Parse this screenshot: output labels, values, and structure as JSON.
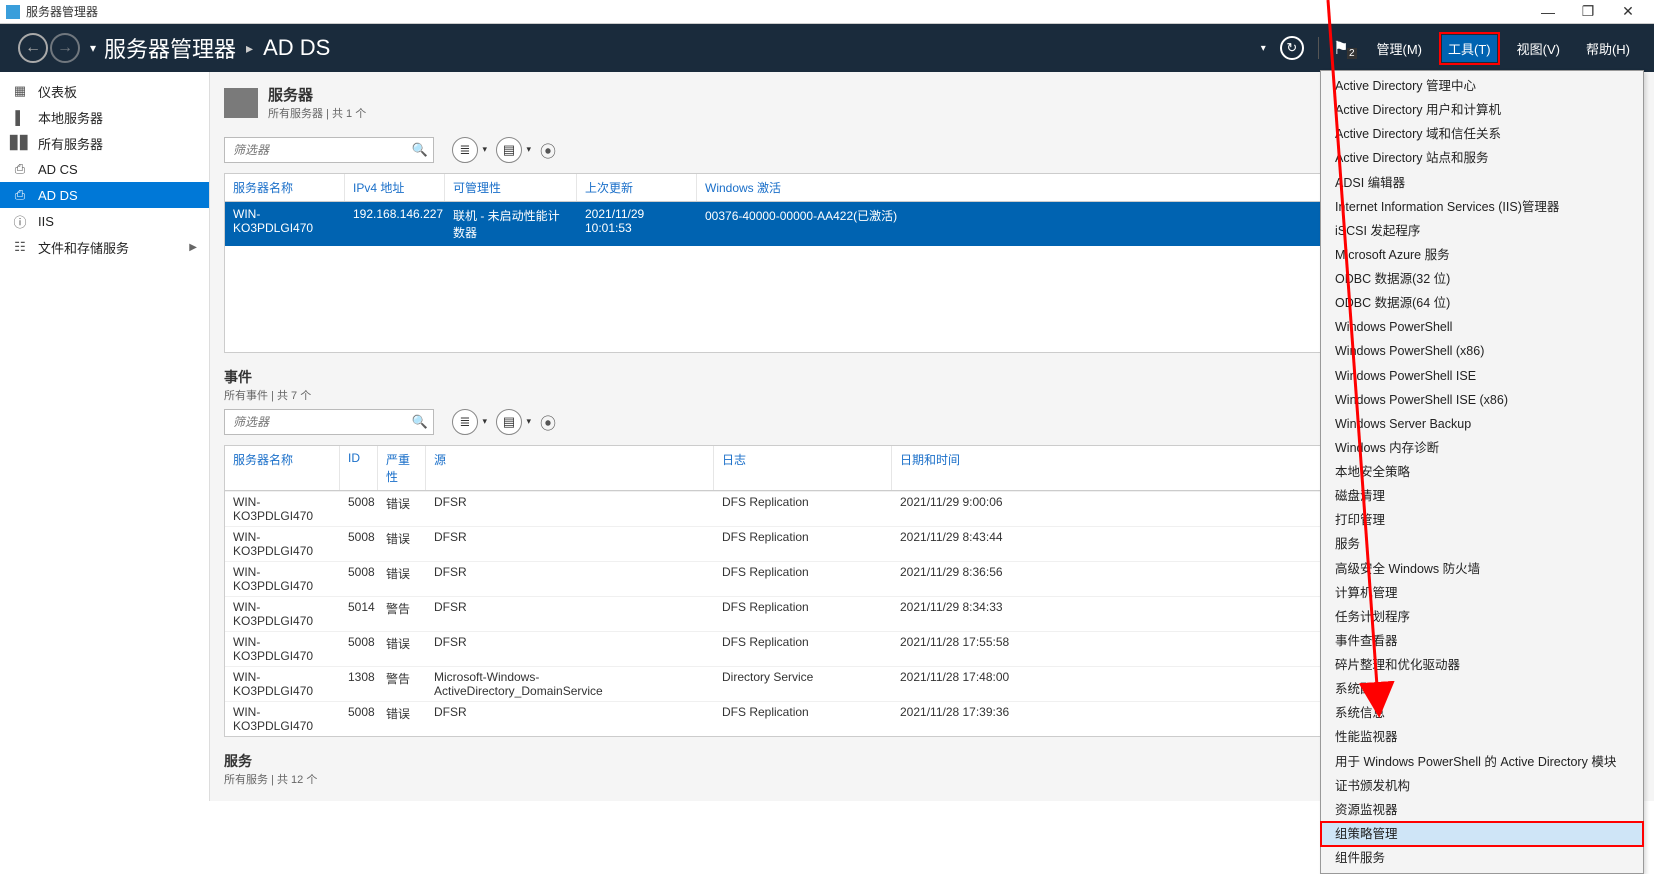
{
  "window": {
    "title": "服务器管理器",
    "min": "—",
    "max": "❐",
    "close": "✕"
  },
  "header": {
    "crumb1": "服务器管理器",
    "crumb2": "AD DS",
    "refresh_icon": "↻",
    "flag_icon": "⚑",
    "flag_count": "2",
    "menu_manage": "管理(M)",
    "menu_tools": "工具(T)",
    "menu_view_partial": "视图(V)",
    "menu_help": "帮助(H)"
  },
  "sidebar": {
    "items": [
      {
        "icon": "▦",
        "label": "仪表板"
      },
      {
        "icon": "▌",
        "label": "本地服务器"
      },
      {
        "icon": "▊▊",
        "label": "所有服务器"
      },
      {
        "icon": "⎙",
        "label": "AD CS"
      },
      {
        "icon": "⎙",
        "label": "AD DS"
      },
      {
        "icon": "ⓘ",
        "label": "IIS"
      },
      {
        "icon": "☷",
        "label": "文件和存储服务",
        "arrow": "▶"
      }
    ]
  },
  "servers_panel": {
    "title": "服务器",
    "subtitle": "所有服务器 | 共 1 个",
    "filter_placeholder": "筛选器",
    "columns": [
      "服务器名称",
      "IPv4 地址",
      "可管理性",
      "上次更新",
      "Windows 激活"
    ],
    "row": {
      "name": "WIN-KO3PDLGI470",
      "ip": "192.168.146.227",
      "manage": "联机 - 未启动性能计数器",
      "updated": "2021/11/29 10:01:53",
      "activation": "00376-40000-00000-AA422(已激活)"
    }
  },
  "events_panel": {
    "title": "事件",
    "subtitle": "所有事件 | 共 7 个",
    "filter_placeholder": "筛选器",
    "columns": [
      "服务器名称",
      "ID",
      "严重性",
      "源",
      "日志",
      "日期和时间"
    ],
    "rows": [
      {
        "name": "WIN-KO3PDLGI470",
        "id": "5008",
        "sev": "错误",
        "src": "DFSR",
        "log": "DFS Replication",
        "dt": "2021/11/29 9:00:06"
      },
      {
        "name": "WIN-KO3PDLGI470",
        "id": "5008",
        "sev": "错误",
        "src": "DFSR",
        "log": "DFS Replication",
        "dt": "2021/11/29 8:43:44"
      },
      {
        "name": "WIN-KO3PDLGI470",
        "id": "5008",
        "sev": "错误",
        "src": "DFSR",
        "log": "DFS Replication",
        "dt": "2021/11/29 8:36:56"
      },
      {
        "name": "WIN-KO3PDLGI470",
        "id": "5014",
        "sev": "警告",
        "src": "DFSR",
        "log": "DFS Replication",
        "dt": "2021/11/29 8:34:33"
      },
      {
        "name": "WIN-KO3PDLGI470",
        "id": "5008",
        "sev": "错误",
        "src": "DFSR",
        "log": "DFS Replication",
        "dt": "2021/11/28 17:55:58"
      },
      {
        "name": "WIN-KO3PDLGI470",
        "id": "1308",
        "sev": "警告",
        "src": "Microsoft-Windows-ActiveDirectory_DomainService",
        "log": "Directory Service",
        "dt": "2021/11/28 17:48:00"
      },
      {
        "name": "WIN-KO3PDLGI470",
        "id": "5008",
        "sev": "错误",
        "src": "DFSR",
        "log": "DFS Replication",
        "dt": "2021/11/28 17:39:36"
      }
    ]
  },
  "services_panel": {
    "title": "服务",
    "subtitle": "所有服务 | 共 12 个"
  },
  "tools_menu": {
    "items": [
      "Active Directory 管理中心",
      "Active Directory 用户和计算机",
      "Active Directory 域和信任关系",
      "Active Directory 站点和服务",
      "ADSI 编辑器",
      "Internet Information Services (IIS)管理器",
      "iSCSI 发起程序",
      "Microsoft Azure 服务",
      "ODBC 数据源(32 位)",
      "ODBC 数据源(64 位)",
      "Windows PowerShell",
      "Windows PowerShell (x86)",
      "Windows PowerShell ISE",
      "Windows PowerShell ISE (x86)",
      "Windows Server Backup",
      "Windows 内存诊断",
      "本地安全策略",
      "磁盘清理",
      "打印管理",
      "服务",
      "高级安全 Windows 防火墙",
      "计算机管理",
      "任务计划程序",
      "事件查看器",
      "碎片整理和优化驱动器",
      "系统配置",
      "系统信息",
      "性能监视器",
      "用于 Windows PowerShell 的 Active Directory 模块",
      "证书颁发机构",
      "资源监视器",
      "组策略管理",
      "组件服务"
    ],
    "highlight_index": 31
  }
}
